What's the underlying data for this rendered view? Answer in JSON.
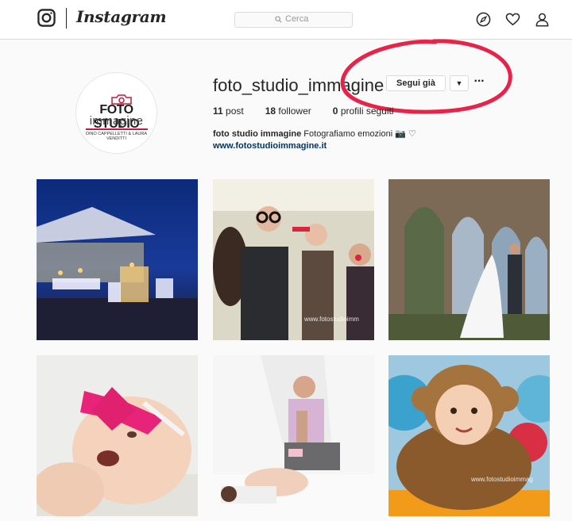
{
  "nav": {
    "brand": "Instagram",
    "search_placeholder": "Cerca",
    "icons": [
      "instagram-logo-icon",
      "search-icon",
      "compass-icon",
      "heart-icon",
      "user-icon"
    ]
  },
  "profile": {
    "username": "foto_studio_immagine",
    "follow_label": "Segui già",
    "dropdown_symbol": "▼",
    "more_symbol": "···",
    "stats": {
      "posts_count": "11",
      "posts_label": "post",
      "followers_count": "18",
      "followers_label": "follower",
      "following_count": "0",
      "following_label": "profili seguiti"
    },
    "bio_name": "foto studio immagine",
    "bio_text": "Fotografiamo emozioni 📷 ♡",
    "website": "www.fotostudioimmagine.it",
    "avatar": {
      "line1": "FOTO STUDIO",
      "line2": "immagine",
      "line3": "DINO CAPPELLETTI & LAURA VENDITTI"
    }
  },
  "posts": [
    {
      "subject": "beach wedding reception at night"
    },
    {
      "subject": "party guests with photo booth props",
      "watermark": "www.fotostudioimm"
    },
    {
      "subject": "bride and groom among ruined arches"
    },
    {
      "subject": "laughing baby with pink bow"
    },
    {
      "subject": "pregnancy couple portrait"
    },
    {
      "subject": "baby in monkey costume",
      "watermark": "www.fotostudioimmag"
    }
  ],
  "colors": {
    "link": "#003569",
    "annotation": "#e8234a",
    "border": "#dbdbdb"
  }
}
